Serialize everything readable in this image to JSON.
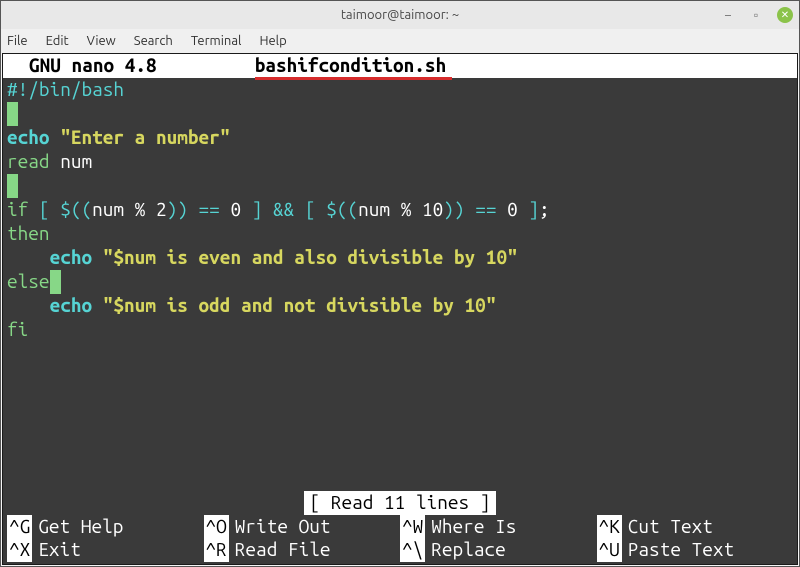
{
  "window": {
    "title": "taimoor@taimoor: ~"
  },
  "menu": {
    "file": "File",
    "edit": "Edit",
    "view": "View",
    "search": "Search",
    "terminal": "Terminal",
    "help": "Help"
  },
  "nano": {
    "app": "GNU nano 4.8",
    "filename": "bashifcondition.sh"
  },
  "code": {
    "l1": "#!/bin/bash",
    "l3_echo": "echo",
    "l3_str": "\"Enter a number\"",
    "l4_read": "read",
    "l4_var": "num",
    "l6_if": "if",
    "l6_lb1": "[",
    "l6_d1": "$((",
    "l6_expr1": "num % 2",
    "l6_dd1": "))",
    "l6_eq": "==",
    "l6_z": "0",
    "l6_rb1": "]",
    "l6_and": "&&",
    "l6_lb2": "[",
    "l6_d2": "$((",
    "l6_expr2": "num % 10",
    "l6_dd2": "))",
    "l6_rb2": "]",
    "l6_semi": ";",
    "l7_then": "then",
    "l8_echo": "echo",
    "l8_str": "\"$num is even and also divisible by 10\"",
    "l9_else": "else",
    "l10_echo": "echo",
    "l10_str": "\"$num is odd and not divisible by 10\"",
    "l11_fi": "fi"
  },
  "status": "[ Read 11 lines ]",
  "shortcuts": {
    "g": {
      "key": "^G",
      "label": "Get Help"
    },
    "o": {
      "key": "^O",
      "label": "Write Out"
    },
    "w": {
      "key": "^W",
      "label": "Where Is"
    },
    "k": {
      "key": "^K",
      "label": "Cut Text"
    },
    "x": {
      "key": "^X",
      "label": "Exit"
    },
    "r": {
      "key": "^R",
      "label": "Read File"
    },
    "bs": {
      "key": "^\\",
      "label": "Replace"
    },
    "u": {
      "key": "^U",
      "label": "Paste Text"
    }
  }
}
